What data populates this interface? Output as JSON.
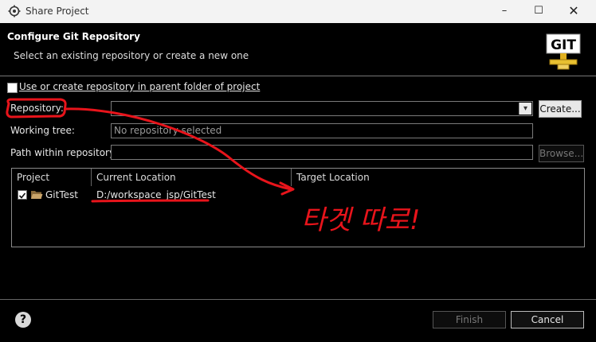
{
  "window": {
    "title": "Share Project",
    "minimize_glyph": "–",
    "maximize_glyph": "☐",
    "close_glyph": "✕"
  },
  "header": {
    "title": "Configure Git Repository",
    "subtitle": "Select an existing repository or create a new one",
    "logo_text": "GIT"
  },
  "form": {
    "use_parent_label": "Use or create repository in parent folder of project",
    "repository_label": "Repository:",
    "repository_value": "",
    "create_button": "Create...",
    "working_tree_label": "Working tree:",
    "working_tree_value": "No repository selected",
    "path_label": "Path within repository:",
    "path_value": "",
    "browse_button": "Browse..."
  },
  "table": {
    "headers": [
      "Project",
      "Current Location",
      "Target Location"
    ],
    "rows": [
      {
        "project": "GitTest",
        "current": "D:/workspace_jsp/GitTest",
        "target": ""
      }
    ]
  },
  "footer": {
    "help_glyph": "?",
    "finish_button": "Finish",
    "cancel_button": "Cancel"
  },
  "annotation": {
    "text": "타겟 따로!",
    "color": "#e8141b"
  }
}
